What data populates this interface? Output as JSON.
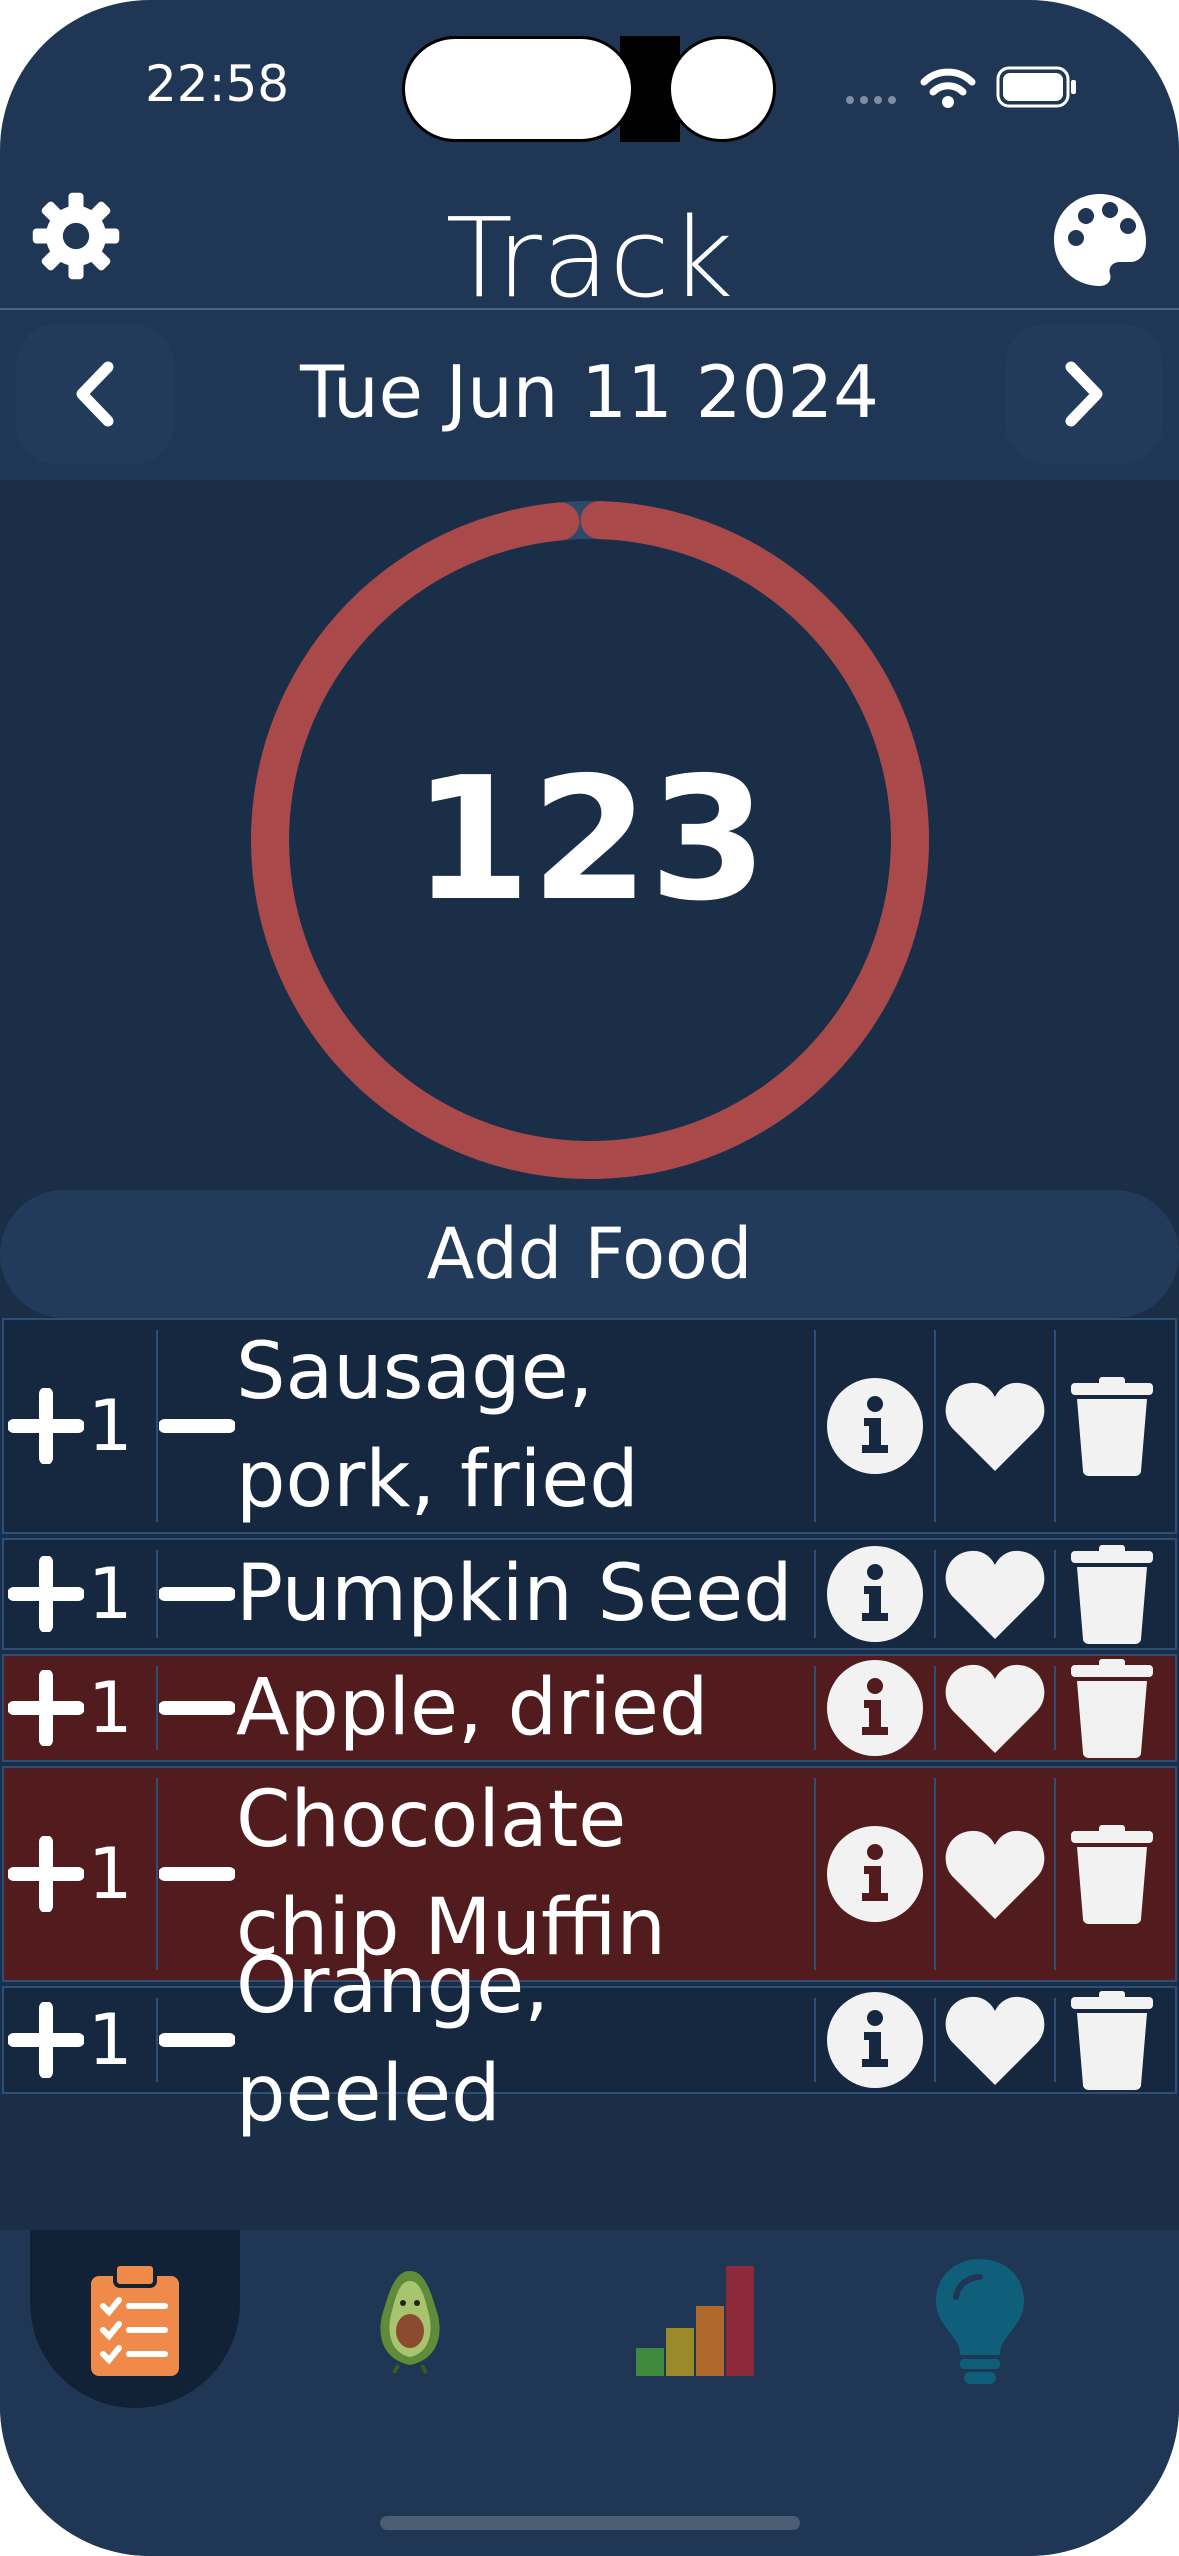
{
  "status": {
    "time": "22:58"
  },
  "header": {
    "title": "Track"
  },
  "date": {
    "label": "Tue Jun 11 2024"
  },
  "progress": {
    "value": "123",
    "fraction": 0.99,
    "ring_color": "#a94949"
  },
  "add_food": {
    "label": "Add Food"
  },
  "foods": [
    {
      "name": "Sausage, pork, fried",
      "count": "1",
      "highlight": false
    },
    {
      "name": "Pumpkin Seed",
      "count": "1",
      "highlight": false
    },
    {
      "name": "Apple, dried",
      "count": "1",
      "highlight": true
    },
    {
      "name": "Chocolate chip Muffin",
      "count": "1",
      "highlight": true
    },
    {
      "name": "Orange, peeled",
      "count": "1",
      "highlight": false
    }
  ],
  "colors": {
    "background": "#1f3654",
    "list_bg": "#16283f",
    "highlight_bg": "#521c1e",
    "accent_orange": "#f08a4b"
  },
  "tabs": [
    {
      "name": "track",
      "icon": "clipboard-icon",
      "active": true
    },
    {
      "name": "mascot",
      "icon": "avocado-icon",
      "active": false
    },
    {
      "name": "stats",
      "icon": "bar-chart-icon",
      "active": false
    },
    {
      "name": "tips",
      "icon": "lightbulb-icon",
      "active": false
    }
  ]
}
